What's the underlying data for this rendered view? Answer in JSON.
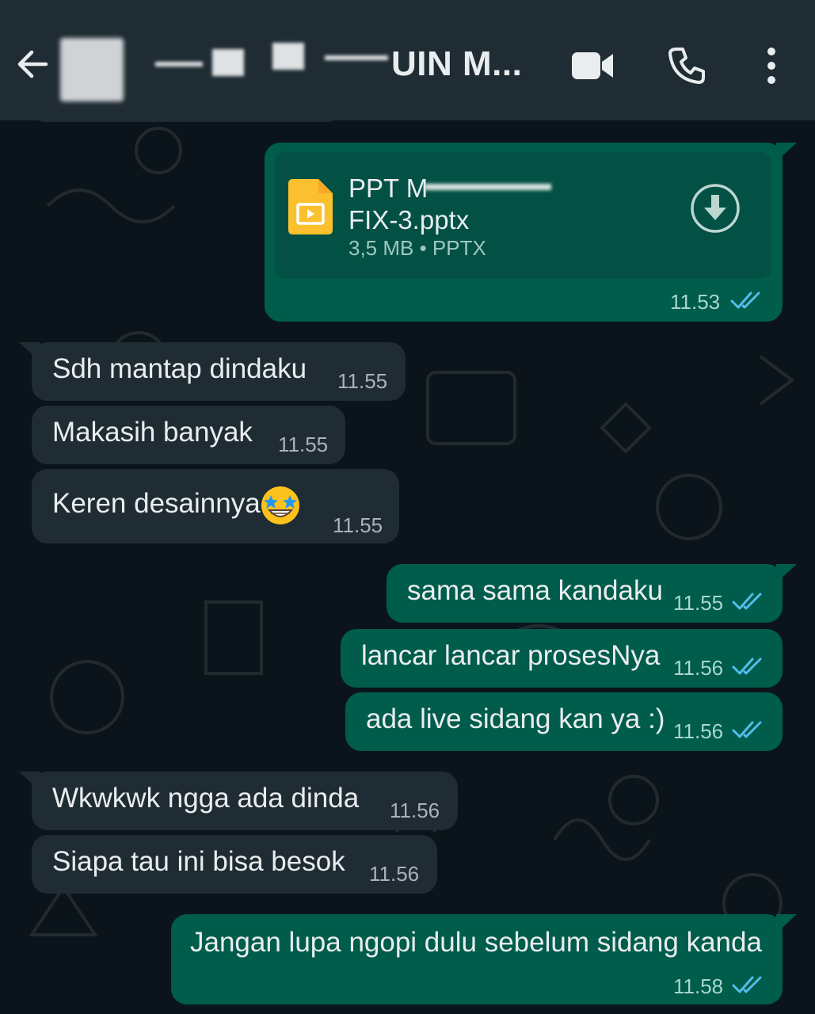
{
  "header": {
    "title": "UIN M...",
    "icons": {
      "back": "arrow-left-icon",
      "video": "video-camera-icon",
      "call": "phone-icon",
      "menu": "more-vertical-icon"
    }
  },
  "document": {
    "name_line1": "PPT M",
    "name_line2": "FIX-3.pptx",
    "meta": "3,5 MB • PPTX",
    "time": "11.53"
  },
  "messages": [
    {
      "text": "Sdh mantap dindaku",
      "time": "11.55"
    },
    {
      "text": "Makasih banyak",
      "time": "11.55"
    },
    {
      "text": "Keren desainnya",
      "time": "11.55"
    },
    {
      "text": "sama sama kandaku",
      "time": "11.55"
    },
    {
      "text": "lancar lancar prosesNya",
      "time": "11.56"
    },
    {
      "text": "ada live sidang kan ya :)",
      "time": "11.56"
    },
    {
      "text": "Wkwkwk ngga ada dinda",
      "time": "11.56"
    },
    {
      "text": "Siapa tau ini bisa besok",
      "time": "11.56"
    },
    {
      "text": "Jangan lupa ngopi dulu sebelum sidang kanda",
      "time": "11.58"
    }
  ],
  "colors": {
    "background": "#0b141a",
    "header": "#1f2c33",
    "incoming_bubble": "#202c33",
    "outgoing_bubble": "#005c4b",
    "read_ticks": "#53bdeb"
  }
}
